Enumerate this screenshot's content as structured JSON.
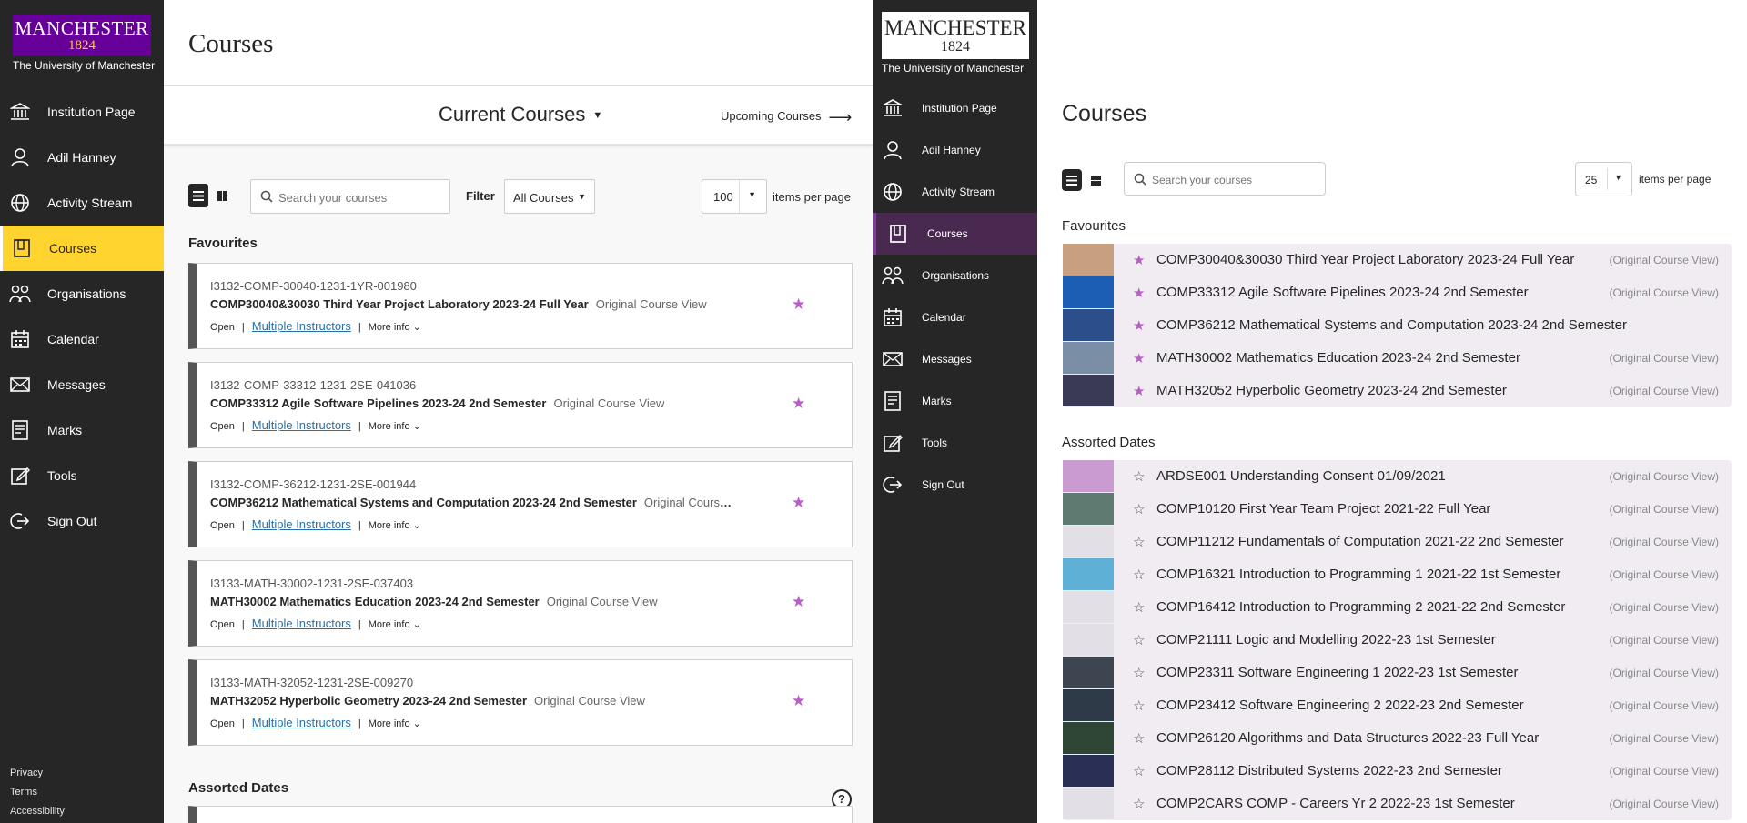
{
  "left": {
    "brand": {
      "logo_word": "MANCHESTER",
      "logo_year": "1824",
      "subtitle": "The University of Manchester"
    },
    "nav": [
      {
        "label": "Institution Page",
        "icon": "institution-icon"
      },
      {
        "label": "Adil Hanney",
        "icon": "user-icon"
      },
      {
        "label": "Activity Stream",
        "icon": "globe-icon"
      },
      {
        "label": "Courses",
        "icon": "courses-icon",
        "active": true
      },
      {
        "label": "Organisations",
        "icon": "organisations-icon"
      },
      {
        "label": "Calendar",
        "icon": "calendar-icon"
      },
      {
        "label": "Messages",
        "icon": "envelope-icon"
      },
      {
        "label": "Marks",
        "icon": "marks-icon"
      },
      {
        "label": "Tools",
        "icon": "tools-icon"
      },
      {
        "label": "Sign Out",
        "icon": "sign-out-icon"
      }
    ],
    "footer": [
      "Privacy",
      "Terms",
      "Accessibility"
    ],
    "title": "Courses",
    "term_selector": "Current Courses",
    "upcoming": "Upcoming Courses",
    "search_placeholder": "Search your courses",
    "filter_label": "Filter",
    "filter_value": "All Courses",
    "per_page": "100",
    "per_page_label": "items per page",
    "favourites_heading": "Favourites",
    "assorted_heading": "Assorted Dates",
    "meta": {
      "open": "Open",
      "instructors": "Multiple Instructors",
      "more": "More info"
    },
    "cards": [
      {
        "id": "I3132-COMP-30040-1231-1YR-001980",
        "title": "COMP30040&30030 Third Year Project Laboratory 2023-24 Full Year",
        "view": "Original Course View"
      },
      {
        "id": "I3132-COMP-33312-1231-2SE-041036",
        "title": "COMP33312 Agile Software Pipelines 2023-24 2nd Semester",
        "view": "Original Course View"
      },
      {
        "id": "I3132-COMP-36212-1231-2SE-001944",
        "title": "COMP36212 Mathematical Systems and Computation 2023-24 2nd Semester",
        "view": "Original Course..."
      },
      {
        "id": "I3133-MATH-30002-1231-2SE-037403",
        "title": "MATH30002 Mathematics Education 2023-24 2nd Semester",
        "view": "Original Course View"
      },
      {
        "id": "I3133-MATH-32052-1231-2SE-009270",
        "title": "MATH32052 Hyperbolic Geometry 2023-24 2nd Semester",
        "view": "Original Course View"
      }
    ]
  },
  "right": {
    "brand": {
      "logo_word": "MANCHESTER",
      "logo_year": "1824",
      "subtitle": "The University of Manchester"
    },
    "nav": [
      {
        "label": "Institution Page",
        "icon": "institution-icon"
      },
      {
        "label": "Adil Hanney",
        "icon": "user-icon"
      },
      {
        "label": "Activity Stream",
        "icon": "globe-icon"
      },
      {
        "label": "Courses",
        "icon": "courses-icon",
        "active": true
      },
      {
        "label": "Organisations",
        "icon": "organisations-icon"
      },
      {
        "label": "Calendar",
        "icon": "calendar-icon"
      },
      {
        "label": "Messages",
        "icon": "envelope-icon"
      },
      {
        "label": "Marks",
        "icon": "marks-icon"
      },
      {
        "label": "Tools",
        "icon": "tools-icon"
      },
      {
        "label": "Sign Out",
        "icon": "sign-out-icon"
      }
    ],
    "title": "Courses",
    "search_placeholder": "Search your courses",
    "per_page": "25",
    "per_page_label": "items per page",
    "favourites_heading": "Favourites",
    "assorted_heading": "Assorted Dates",
    "view_label": "(Original Course View)",
    "favourites": [
      {
        "name": "COMP30040&30030 Third Year Project Laboratory 2023-24 Full Year",
        "show_view": true,
        "thumb": "#c8a080"
      },
      {
        "name": "COMP33312 Agile Software Pipelines 2023-24 2nd Semester",
        "show_view": true,
        "thumb": "#1a5fb4"
      },
      {
        "name": "COMP36212 Mathematical Systems and Computation 2023-24 2nd Semester",
        "show_view": false,
        "thumb": "#2c4f8c"
      },
      {
        "name": "MATH30002 Mathematics Education 2023-24 2nd Semester",
        "show_view": true,
        "thumb": "#7a8fa6"
      },
      {
        "name": "MATH32052 Hyperbolic Geometry 2023-24 2nd Semester",
        "show_view": true,
        "thumb": "#3a3a55"
      }
    ],
    "assorted": [
      {
        "name": "ARDSE001 Understanding Consent 01/09/2021",
        "thumb": "#c99bd0"
      },
      {
        "name": "COMP10120 First Year Team Project 2021-22 Full Year",
        "thumb": "#5f7a70"
      },
      {
        "name": "COMP11212 Fundamentals of Computation 2021-22 2nd Semester",
        "thumb": ""
      },
      {
        "name": "COMP16321 Introduction to Programming 1 2021-22 1st Semester",
        "thumb": "#5fb0d6"
      },
      {
        "name": "COMP16412 Introduction to Programming 2 2021-22 2nd Semester",
        "thumb": ""
      },
      {
        "name": "COMP21111 Logic and Modelling 2022-23 1st Semester",
        "thumb": ""
      },
      {
        "name": "COMP23311 Software Engineering 1 2022-23 1st Semester",
        "thumb": "#3d4550"
      },
      {
        "name": "COMP23412 Software Engineering 2 2022-23 2nd Semester",
        "thumb": "#2e3a48"
      },
      {
        "name": "COMP26120 Algorithms and Data Structures 2022-23 Full Year",
        "thumb": "#2f4535"
      },
      {
        "name": "COMP28112 Distributed Systems 2022-23 2nd Semester",
        "thumb": "#2a2f55"
      },
      {
        "name": "COMP2CARS COMP - Careers Yr 2 2022-23 1st Semester",
        "thumb": ""
      }
    ]
  }
}
